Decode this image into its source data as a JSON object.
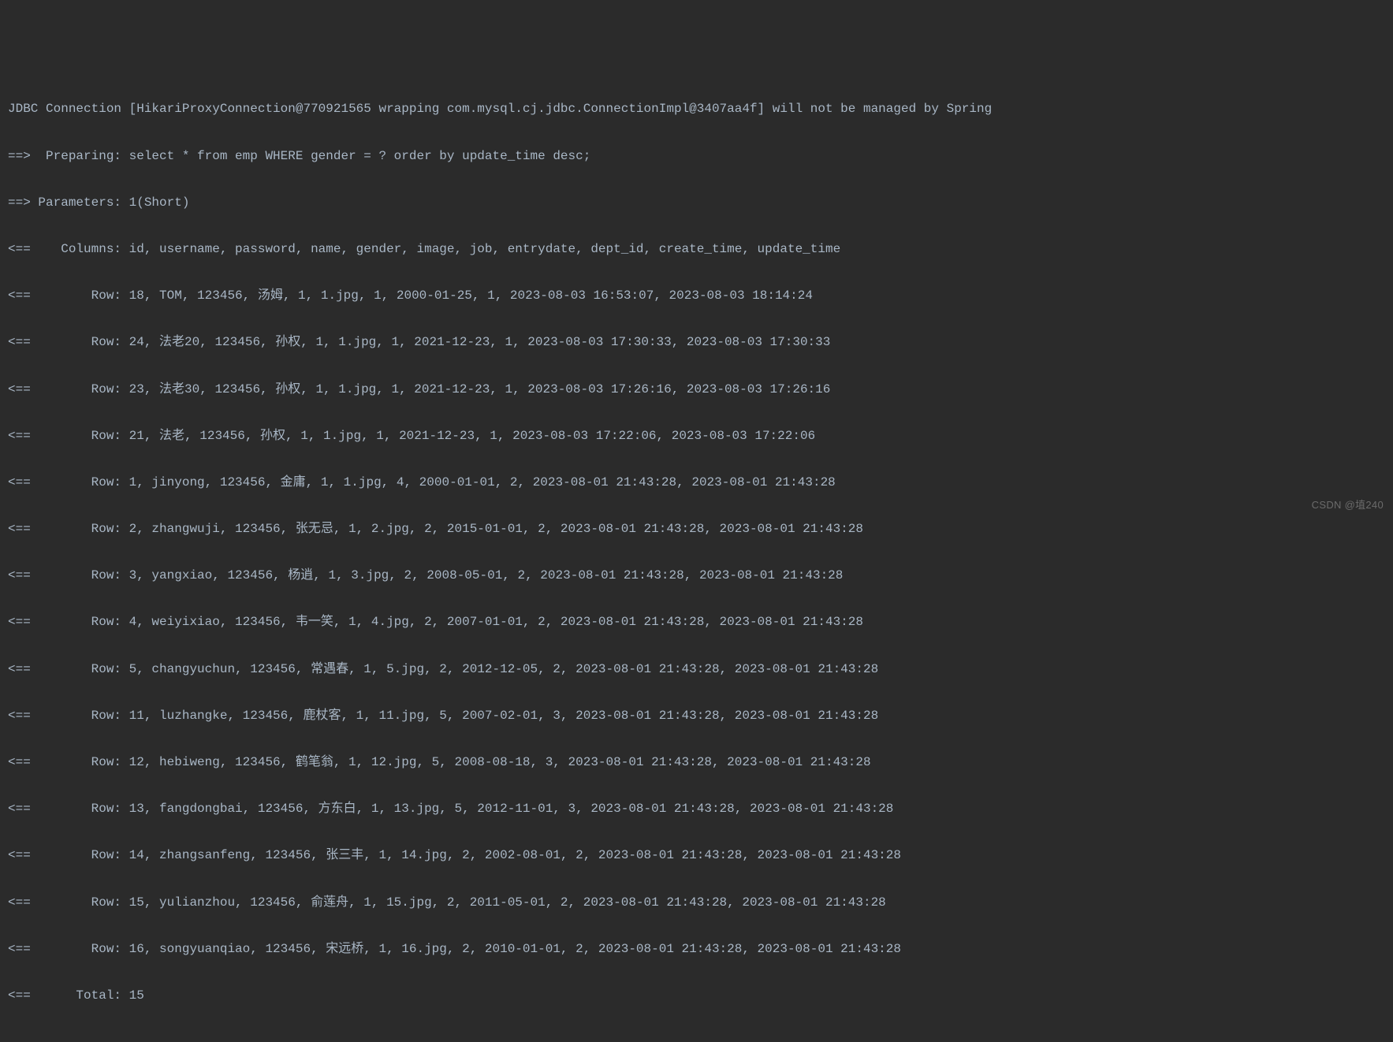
{
  "log": {
    "connection": "JDBC Connection [HikariProxyConnection@770921565 wrapping com.mysql.cj.jdbc.ConnectionImpl@3407aa4f] will not be managed by Spring",
    "preparing": "==>  Preparing: select * from emp WHERE gender = ? order by update_time desc;",
    "parameters": "==> Parameters: 1(Short)",
    "columns": "<==    Columns: id, username, password, name, gender, image, job, entrydate, dept_id, create_time, update_time",
    "rows": [
      "<==        Row: 18, TOM, 123456, 汤姆, 1, 1.jpg, 1, 2000-01-25, 1, 2023-08-03 16:53:07, 2023-08-03 18:14:24",
      "<==        Row: 24, 法老20, 123456, 孙权, 1, 1.jpg, 1, 2021-12-23, 1, 2023-08-03 17:30:33, 2023-08-03 17:30:33",
      "<==        Row: 23, 法老30, 123456, 孙权, 1, 1.jpg, 1, 2021-12-23, 1, 2023-08-03 17:26:16, 2023-08-03 17:26:16",
      "<==        Row: 21, 法老, 123456, 孙权, 1, 1.jpg, 1, 2021-12-23, 1, 2023-08-03 17:22:06, 2023-08-03 17:22:06",
      "<==        Row: 1, jinyong, 123456, 金庸, 1, 1.jpg, 4, 2000-01-01, 2, 2023-08-01 21:43:28, 2023-08-01 21:43:28",
      "<==        Row: 2, zhangwuji, 123456, 张无忌, 1, 2.jpg, 2, 2015-01-01, 2, 2023-08-01 21:43:28, 2023-08-01 21:43:28",
      "<==        Row: 3, yangxiao, 123456, 杨逍, 1, 3.jpg, 2, 2008-05-01, 2, 2023-08-01 21:43:28, 2023-08-01 21:43:28",
      "<==        Row: 4, weiyixiao, 123456, 韦一笑, 1, 4.jpg, 2, 2007-01-01, 2, 2023-08-01 21:43:28, 2023-08-01 21:43:28",
      "<==        Row: 5, changyuchun, 123456, 常遇春, 1, 5.jpg, 2, 2012-12-05, 2, 2023-08-01 21:43:28, 2023-08-01 21:43:28",
      "<==        Row: 11, luzhangke, 123456, 鹿杖客, 1, 11.jpg, 5, 2007-02-01, 3, 2023-08-01 21:43:28, 2023-08-01 21:43:28",
      "<==        Row: 12, hebiweng, 123456, 鹤笔翁, 1, 12.jpg, 5, 2008-08-18, 3, 2023-08-01 21:43:28, 2023-08-01 21:43:28",
      "<==        Row: 13, fangdongbai, 123456, 方东白, 1, 13.jpg, 5, 2012-11-01, 3, 2023-08-01 21:43:28, 2023-08-01 21:43:28",
      "<==        Row: 14, zhangsanfeng, 123456, 张三丰, 1, 14.jpg, 2, 2002-08-01, 2, 2023-08-01 21:43:28, 2023-08-01 21:43:28",
      "<==        Row: 15, yulianzhou, 123456, 俞莲舟, 1, 15.jpg, 2, 2011-05-01, 2, 2023-08-01 21:43:28, 2023-08-01 21:43:28",
      "<==        Row: 16, songyuanqiao, 123456, 宋远桥, 1, 16.jpg, 2, 2010-01-01, 2, 2023-08-01 21:43:28, 2023-08-01 21:43:28"
    ],
    "total": "<==      Total: 15"
  },
  "watermark": "CSDN @埴240"
}
